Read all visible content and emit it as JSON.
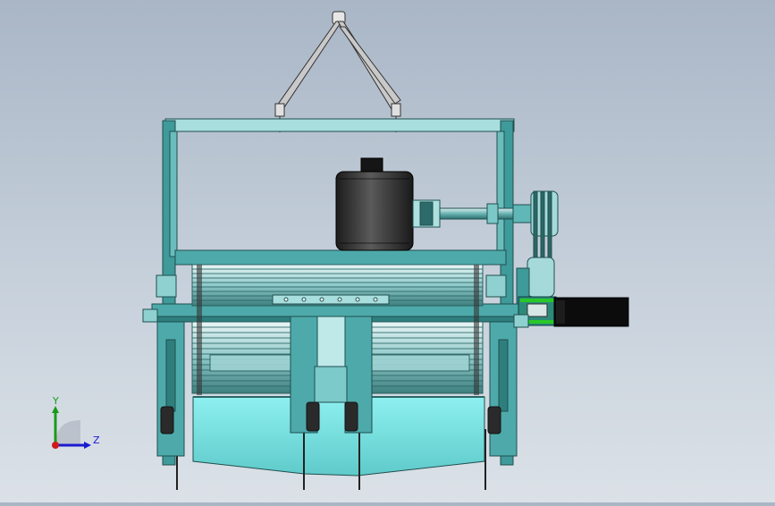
{
  "viewport": {
    "background_top": "#a9b6c6",
    "background_bottom": "#dbe1e7",
    "model_colors": {
      "frame": "#3f9a9a",
      "frame_light": "#7cc8c8",
      "hopper": "#7fe3e3",
      "motor": "#2b2b2b",
      "gearbox": "#111111",
      "belt_accent": "#28c828"
    }
  },
  "triad": {
    "y_label": "Y",
    "z_label": "Z",
    "y_color": "#1a9a1a",
    "z_color": "#1a1ad0",
    "x_color": "#d01a1a"
  }
}
